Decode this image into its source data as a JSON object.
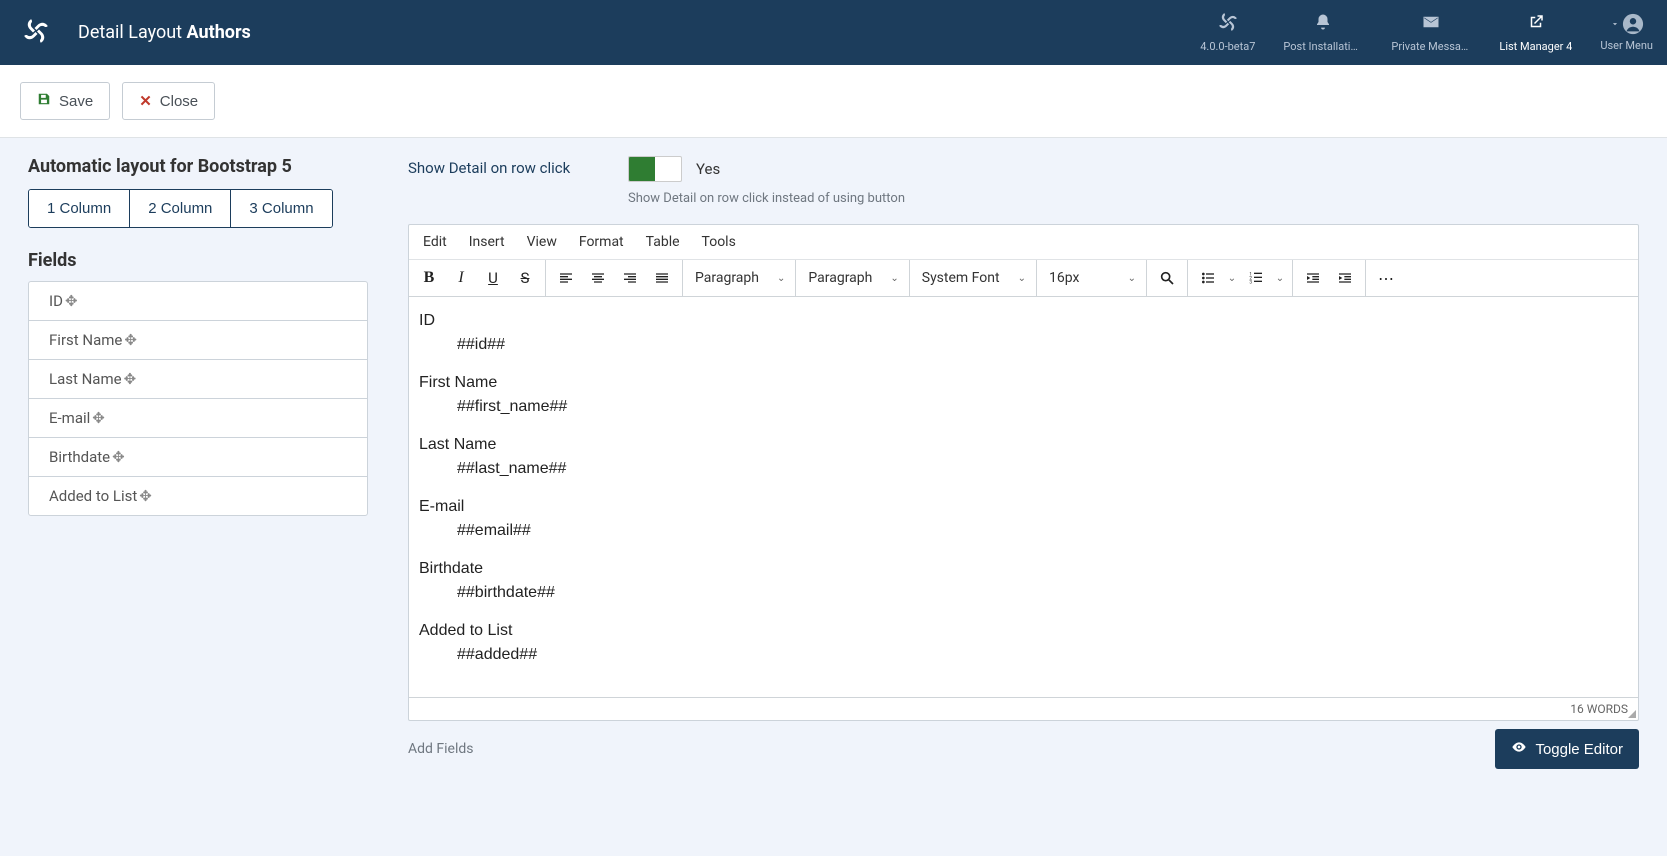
{
  "header": {
    "page_title_prefix": "Detail Layout ",
    "page_title_strong": "Authors",
    "nav": [
      {
        "label": "4.0.0-beta7",
        "icon": "joomla"
      },
      {
        "label": "Post Installation ...",
        "icon": "bell"
      },
      {
        "label": "Private Messages",
        "icon": "envelope"
      },
      {
        "label": "List Manager 4",
        "icon": "external",
        "active": true
      },
      {
        "label": "User Menu",
        "icon": "user"
      }
    ]
  },
  "actions": {
    "save": "Save",
    "close": "Close"
  },
  "sidebar": {
    "layout_heading": "Automatic layout for Bootstrap 5",
    "columns": [
      "1 Column",
      "2 Column",
      "3 Column"
    ],
    "fields_heading": "Fields",
    "fields": [
      "ID",
      "First Name",
      "Last Name",
      "E-mail",
      "Birthdate",
      "Added to List"
    ]
  },
  "main": {
    "show_detail_label": "Show Detail on row click",
    "show_detail_value": "Yes",
    "show_detail_help": "Show Detail on row click instead of using button",
    "menubar": [
      "Edit",
      "Insert",
      "View",
      "Format",
      "Table",
      "Tools"
    ],
    "toolbar": {
      "para1": "Paragraph",
      "para2": "Paragraph",
      "font": "System Font",
      "size": "16px"
    },
    "body": [
      {
        "label": "ID",
        "value": "##id##"
      },
      {
        "label": "First Name",
        "value": "##first_name##"
      },
      {
        "label": "Last Name",
        "value": "##last_name##"
      },
      {
        "label": "E-mail",
        "value": "##email##"
      },
      {
        "label": "Birthdate",
        "value": "##birthdate##"
      },
      {
        "label": "Added to List",
        "value": "##added##"
      }
    ],
    "word_count": "16 WORDS",
    "add_fields": "Add Fields",
    "toggle_editor": "Toggle Editor"
  }
}
